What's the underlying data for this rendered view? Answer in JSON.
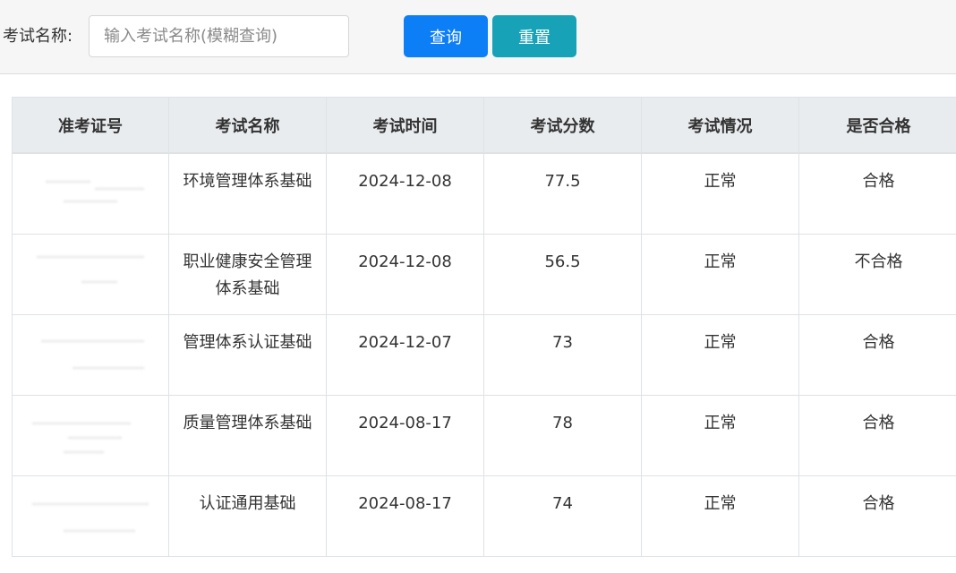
{
  "search": {
    "label": "考试名称:",
    "placeholder": "输入考试名称(模糊查询)",
    "value": "",
    "query_button": "查询",
    "reset_button": "重置"
  },
  "table": {
    "headers": [
      "准考证号",
      "考试名称",
      "考试时间",
      "考试分数",
      "考试情况",
      "是否合格"
    ],
    "rows": [
      {
        "ticket": "",
        "name": "环境管理体系基础",
        "date": "2024-12-08",
        "score": "77.5",
        "status": "正常",
        "pass": "合格"
      },
      {
        "ticket": "",
        "name": "职业健康安全管理体系基础",
        "date": "2024-12-08",
        "score": "56.5",
        "status": "正常",
        "pass": "不合格"
      },
      {
        "ticket": "",
        "name": "管理体系认证基础",
        "date": "2024-12-07",
        "score": "73",
        "status": "正常",
        "pass": "合格"
      },
      {
        "ticket": "",
        "name": "质量管理体系基础",
        "date": "2024-08-17",
        "score": "78",
        "status": "正常",
        "pass": "合格"
      },
      {
        "ticket": "",
        "name": "认证通用基础",
        "date": "2024-08-17",
        "score": "74",
        "status": "正常",
        "pass": "合格"
      }
    ]
  },
  "colors": {
    "primary": "#0d7ff6",
    "info": "#17a2b8",
    "header_bg": "#e9ecef",
    "border": "#dee2e6"
  }
}
